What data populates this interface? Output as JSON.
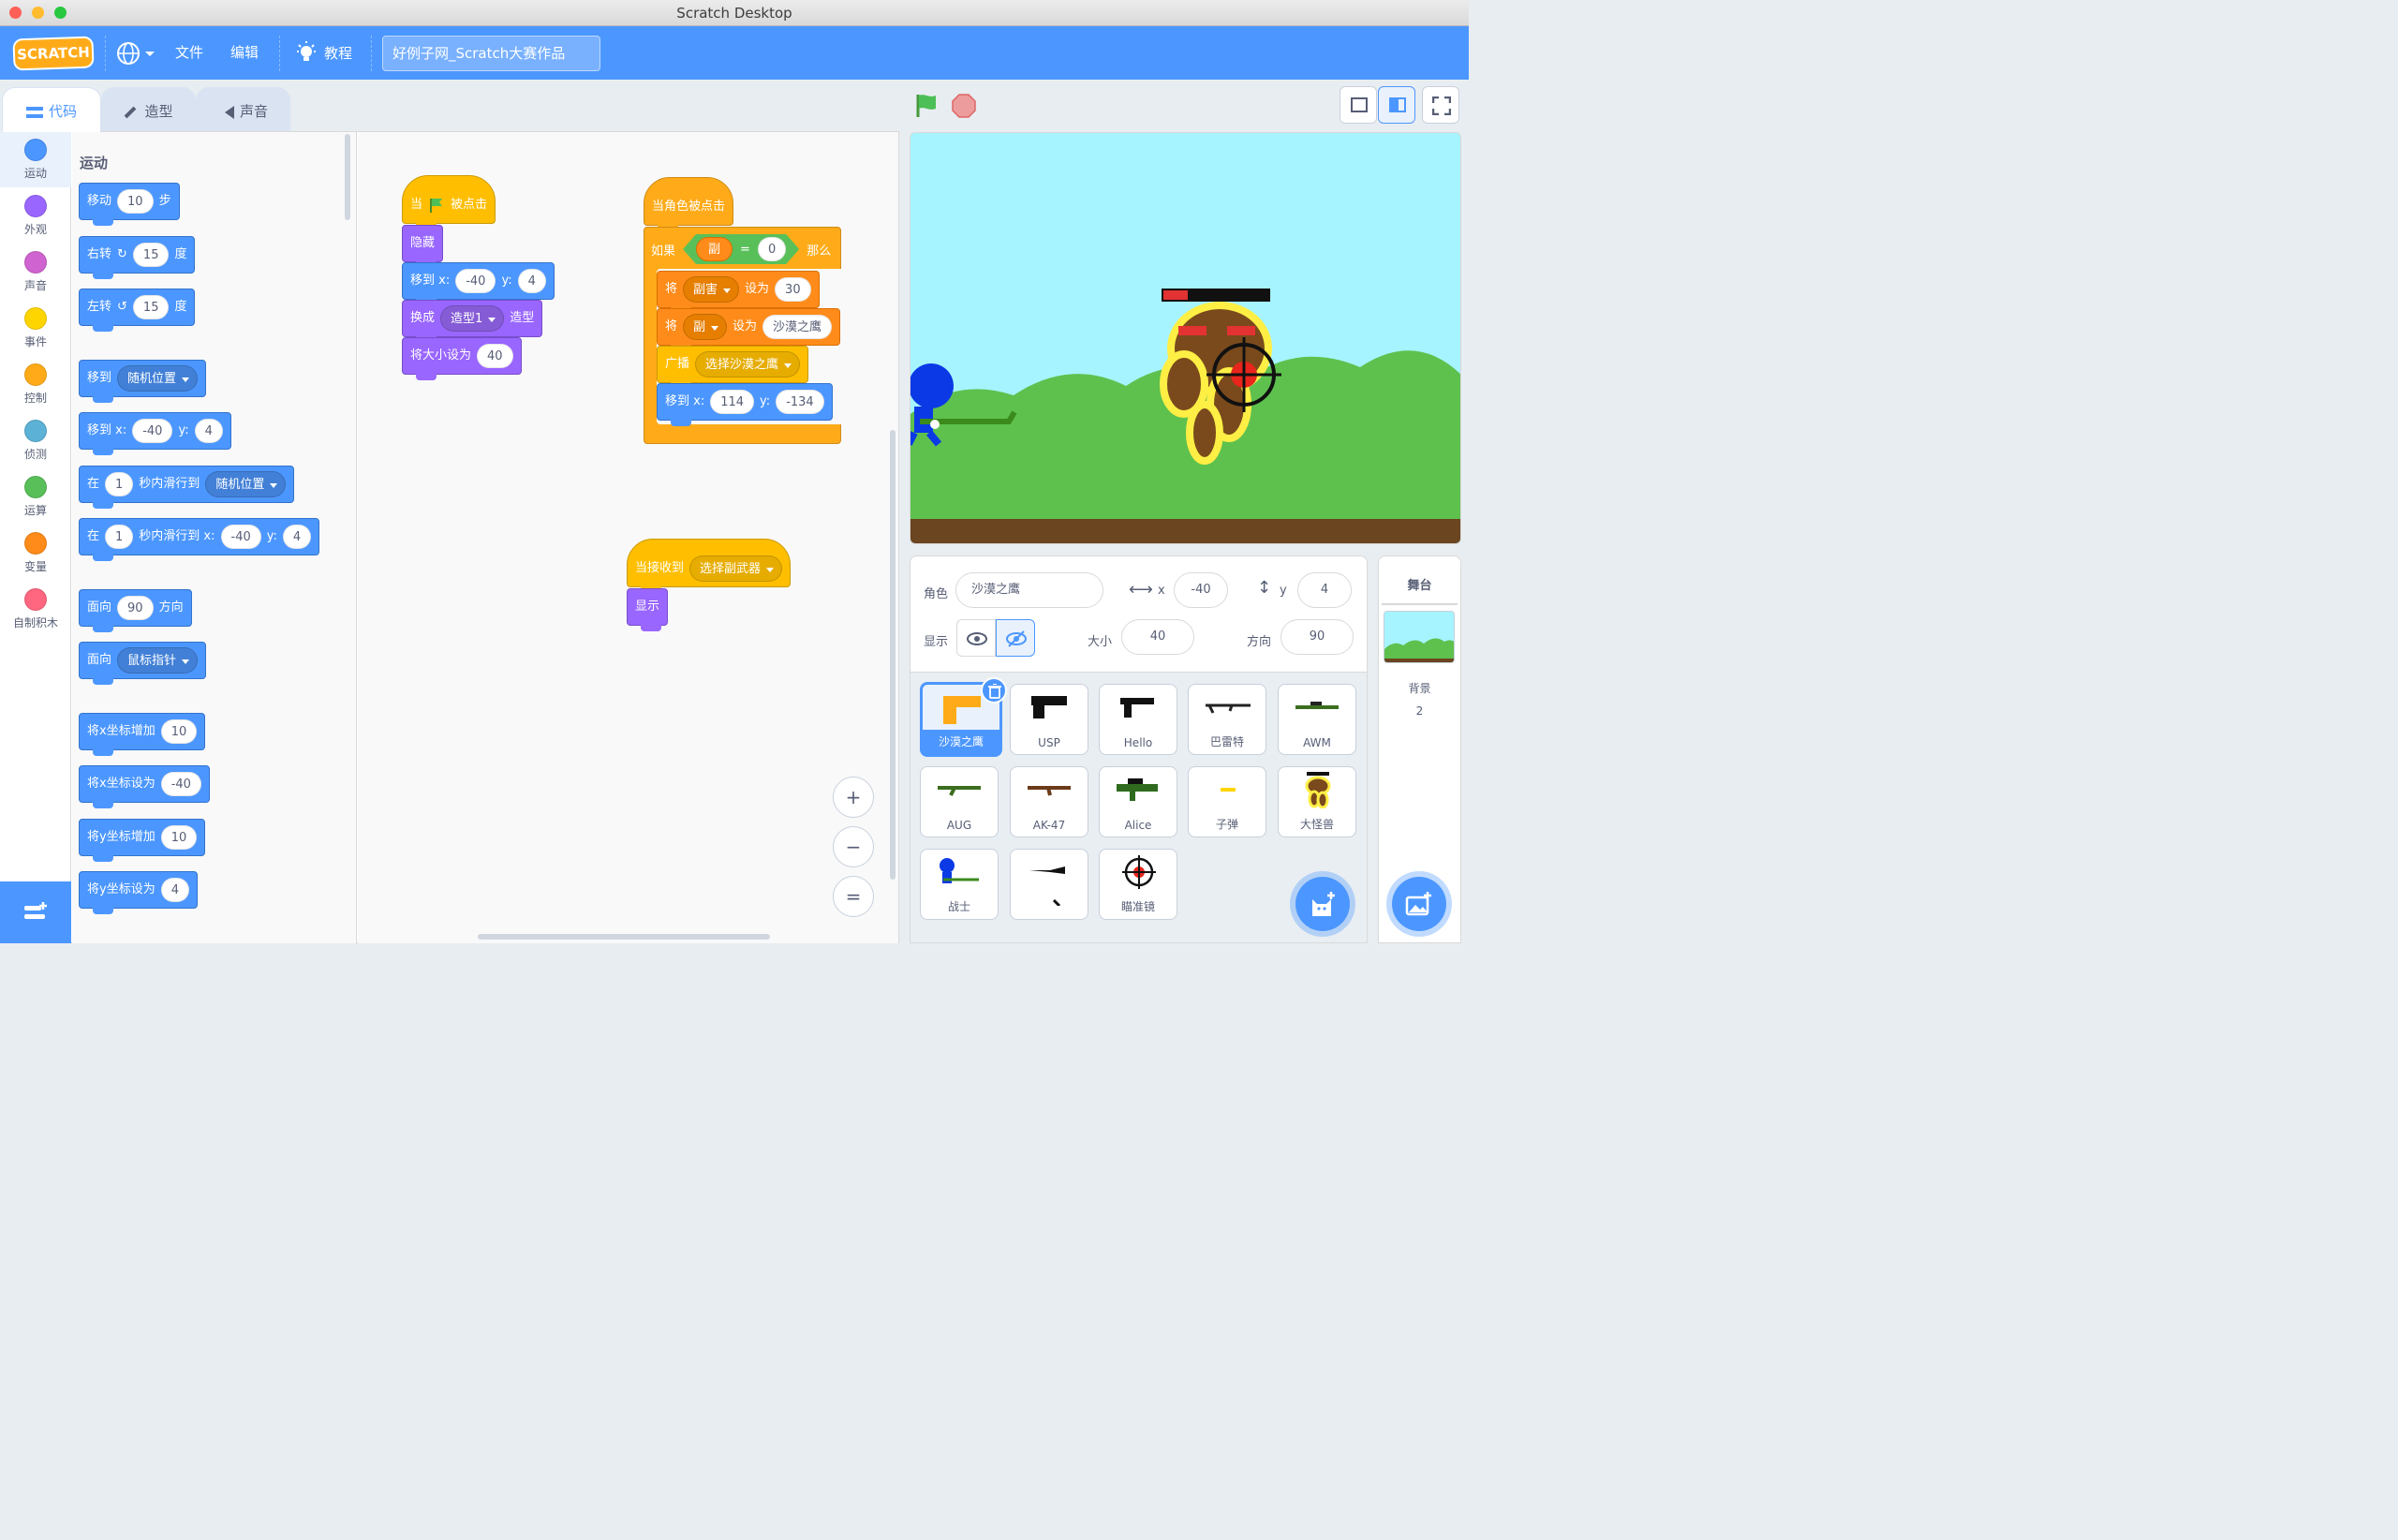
{
  "window": {
    "title": "Scratch Desktop"
  },
  "menu": {
    "logo": "SCRATCH",
    "file": "文件",
    "edit": "编辑",
    "tutorials": "教程",
    "project_title": "好例子网_Scratch大赛作品"
  },
  "tabs": {
    "code": "代码",
    "costumes": "造型",
    "sounds": "声音"
  },
  "categories": [
    {
      "label": "运动",
      "color": "#4c97ff"
    },
    {
      "label": "外观",
      "color": "#9966ff"
    },
    {
      "label": "声音",
      "color": "#cf63cf"
    },
    {
      "label": "事件",
      "color": "#ffd500"
    },
    {
      "label": "控制",
      "color": "#ffab19"
    },
    {
      "label": "侦测",
      "color": "#5cb1d6"
    },
    {
      "label": "运算",
      "color": "#59c059"
    },
    {
      "label": "变量",
      "color": "#ff8c1a"
    },
    {
      "label": "自制积木",
      "color": "#ff6680"
    }
  ],
  "palette": {
    "title": "运动",
    "move": {
      "a": "移动",
      "v": "10",
      "b": "步"
    },
    "turn_right": {
      "a": "右转",
      "v": "15",
      "b": "度"
    },
    "turn_left": {
      "a": "左转",
      "v": "15",
      "b": "度"
    },
    "goto": {
      "a": "移到",
      "dd": "随机位置"
    },
    "goto_xy": {
      "a": "移到 x:",
      "x": "-40",
      "b": "y:",
      "y": "4"
    },
    "glide": {
      "a": "在",
      "v": "1",
      "b": "秒内滑行到",
      "dd": "随机位置"
    },
    "glide_xy": {
      "a": "在",
      "v": "1",
      "b": "秒内滑行到 x:",
      "x": "-40",
      "c": "y:",
      "y": "4"
    },
    "point_dir": {
      "a": "面向",
      "v": "90",
      "b": "方向"
    },
    "point_towards": {
      "a": "面向",
      "dd": "鼠标指针"
    },
    "change_x": {
      "a": "将x坐标增加",
      "v": "10"
    },
    "set_x": {
      "a": "将x坐标设为",
      "v": "-40"
    },
    "change_y": {
      "a": "将y坐标增加",
      "v": "10"
    },
    "set_y": {
      "a": "将y坐标设为",
      "v": "4"
    }
  },
  "script1": {
    "hat_a": "当",
    "hat_b": "被点击",
    "hide": "隐藏",
    "goto_a": "移到 x:",
    "goto_x": "-40",
    "goto_b": "y:",
    "goto_y": "4",
    "costume_a": "换成",
    "costume_dd": "造型1",
    "costume_b": "造型",
    "size_a": "将大小设为",
    "size_v": "40"
  },
  "script2": {
    "hat": "当角色被点击",
    "if_a": "如果",
    "var": "副",
    "eq": "=",
    "cmp": "0",
    "if_b": "那么",
    "set1_a": "将",
    "set1_dd": "副害",
    "set1_b": "设为",
    "set1_v": "30",
    "set2_a": "将",
    "set2_dd": "副",
    "set2_b": "设为",
    "set2_v": "沙漠之鹰",
    "bc_a": "广播",
    "bc_dd": "选择沙漠之鹰",
    "goto_a": "移到 x:",
    "goto_x": "114",
    "goto_b": "y:",
    "goto_y": "-134"
  },
  "script3": {
    "hat_a": "当接收到",
    "hat_dd": "选择副武器",
    "show": "显示"
  },
  "zoom": {
    "in": "+",
    "out": "−",
    "reset": "="
  },
  "sprite_info": {
    "sprite_label": "角色",
    "sprite_name": "沙漠之鹰",
    "x_label": "x",
    "x": "-40",
    "y_label": "y",
    "y": "4",
    "show_label": "显示",
    "size_label": "大小",
    "size": "40",
    "dir_label": "方向",
    "dir": "90"
  },
  "sprites": [
    "沙漠之鹰",
    "USP",
    "Hello",
    "巴雷特",
    "AWM",
    "AUG",
    "AK-47",
    "Alice",
    "子弹",
    "大怪兽",
    "战士",
    "",
    "瞄准镜"
  ],
  "stage_panel": {
    "title": "舞台",
    "bg_label": "背景",
    "bg_count": "2"
  },
  "colors": {
    "brand": "#4c97ff",
    "motion": "#4c97ff",
    "looks": "#9966ff",
    "events": "#ffbf00",
    "control": "#ffab19",
    "vars": "#ff8c1a",
    "operators": "#59c059"
  }
}
